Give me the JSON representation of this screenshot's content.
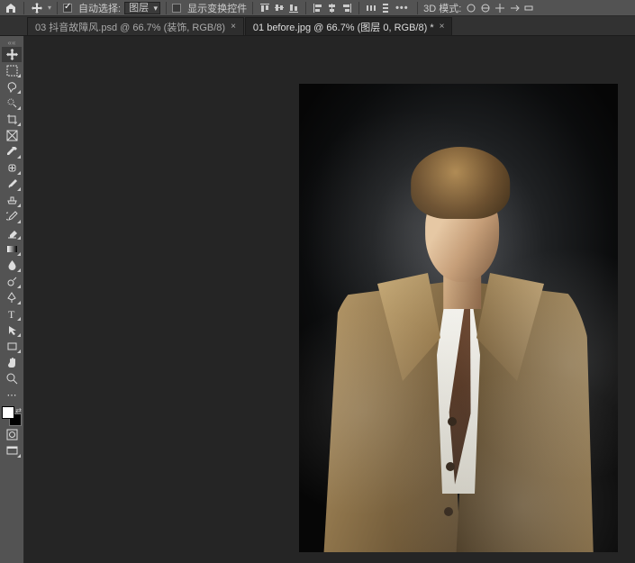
{
  "options": {
    "auto_select": {
      "label": "自动选择:",
      "checked": true
    },
    "target_dropdown": "图层",
    "show_transform": {
      "label": "显示变换控件",
      "checked": false
    },
    "mode_3d_label": "3D 模式:"
  },
  "tabs": [
    {
      "title": "03 抖音故障风.psd @ 66.7% (装饰, RGB/8)",
      "active": false
    },
    {
      "title": "01 before.jpg @ 66.7% (图层 0, RGB/8) *",
      "active": true
    }
  ],
  "tools": {
    "items": [
      "move-tool",
      "marquee-tool",
      "lasso-tool",
      "quick-select-tool",
      "crop-tool",
      "frame-tool",
      "eyedropper-tool",
      "healing-brush-tool",
      "brush-tool",
      "clone-stamp-tool",
      "history-brush-tool",
      "eraser-tool",
      "gradient-tool",
      "blur-tool",
      "dodge-tool",
      "pen-tool",
      "type-tool",
      "path-select-tool",
      "rectangle-tool",
      "hand-tool",
      "zoom-tool"
    ],
    "has_submenu": [
      false,
      true,
      true,
      true,
      true,
      false,
      true,
      true,
      true,
      true,
      true,
      true,
      true,
      true,
      true,
      true,
      true,
      true,
      true,
      false,
      false
    ],
    "extras": [
      "edit-toolbar",
      "quick-mask-tool",
      "change-screen-mode"
    ]
  },
  "swatches": {
    "foreground": "#ffffff",
    "background": "#000000"
  }
}
